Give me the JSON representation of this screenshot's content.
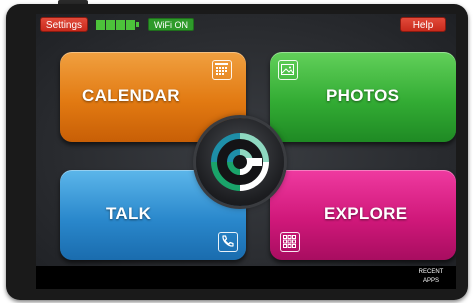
{
  "topbar": {
    "settings_label": "Settings",
    "help_label": "Help",
    "wifi_label": "WiFi ON",
    "battery_level": 1.0
  },
  "tiles": [
    {
      "label": "CALENDAR",
      "icon": "calendar-icon",
      "color": "#e27a12"
    },
    {
      "label": "PHOTOS",
      "icon": "image-icon",
      "color": "#33ac34"
    },
    {
      "label": "TALK",
      "icon": "phone-icon",
      "color": "#2a88cc"
    },
    {
      "label": "EXPLORE",
      "icon": "grid-icon",
      "color": "#d0187a"
    }
  ],
  "center": {
    "icon": "home-logo-icon"
  },
  "bottom": {
    "recent_line1": "RECENT",
    "recent_line2": "APPS"
  }
}
